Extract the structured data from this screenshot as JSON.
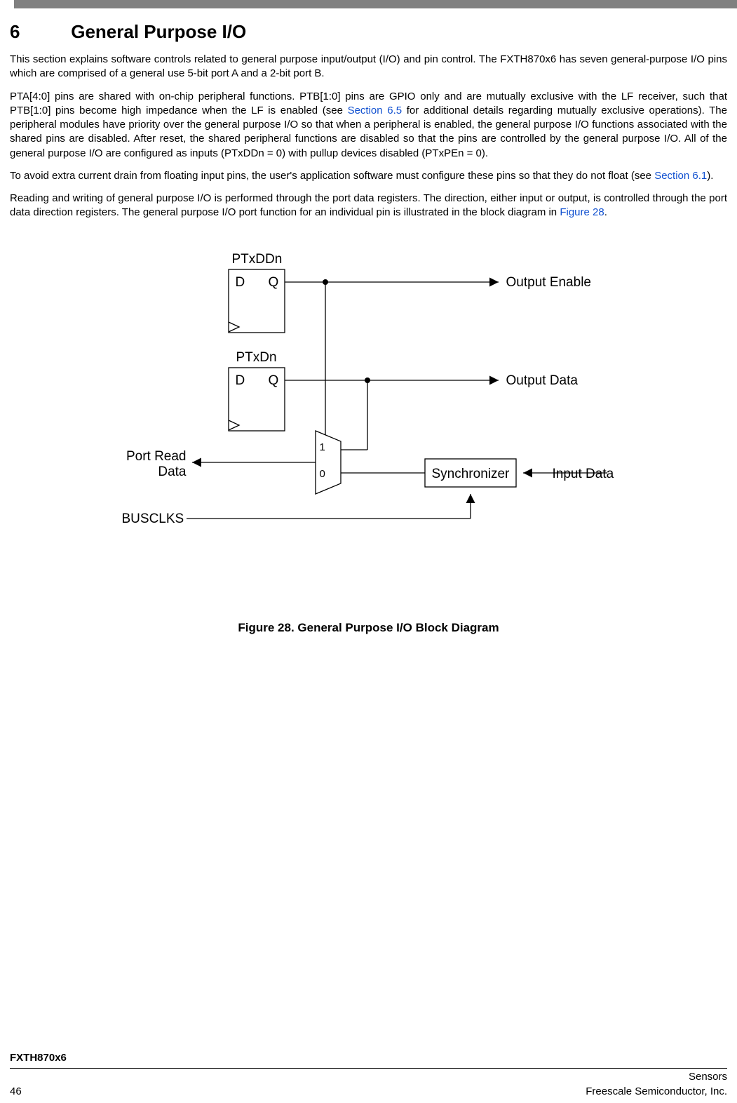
{
  "section": {
    "number": "6",
    "title": "General Purpose I/O"
  },
  "para1": "This section explains software controls related to general purpose input/output (I/O) and pin control. The FXTH870x6 has seven general-purpose I/O pins which are comprised of a general use 5-bit port A and a 2-bit port B.",
  "para2a": "PTA[4:0] pins are shared with on-chip peripheral functions. PTB[1:0] pins are GPIO only and are mutually exclusive with the LF receiver, such that PTB[1:0] pins become high impedance when the LF is enabled (see ",
  "para2_link1": "Section 6.5",
  "para2b": " for additional details regarding mutually exclusive operations). The peripheral modules have priority over the general purpose I/O so that when a peripheral is enabled, the general purpose I/O functions associated with the shared pins are disabled. After reset, the shared peripheral functions are disabled so that the pins are controlled by the general purpose I/O. All of the general purpose I/O are configured as inputs (PTxDDn = 0) with pullup devices disabled (PTxPEn = 0).",
  "para3a": "To avoid extra current drain from floating input pins, the user's application software must configure these pins so that they do not float (see ",
  "para3_link1": "Section 6.1",
  "para3b": ").",
  "para4a": "Reading and writing of general purpose I/O is performed through the port data registers. The direction, either input or output, is controlled through the port data direction registers. The general purpose I/O port function for an individual pin is illustrated in the block diagram in ",
  "para4_link1": "Figure 28",
  "para4b": ".",
  "diagram": {
    "ptxddn": "PTxDDn",
    "ptxdn": "PTxDn",
    "d": "D",
    "q": "Q",
    "out_enable": "Output Enable",
    "out_data": "Output Data",
    "port_read": "Port Read",
    "data": "Data",
    "synchronizer": "Synchronizer",
    "input_data": "Input Data",
    "busclks": "BUSCLKS",
    "mux1": "1",
    "mux0": "0"
  },
  "figure_caption": "Figure 28. General Purpose I/O Block Diagram",
  "footer": {
    "part": "FXTH870x6",
    "right1": "Sensors",
    "page": "46",
    "right2": "Freescale Semiconductor, Inc."
  }
}
